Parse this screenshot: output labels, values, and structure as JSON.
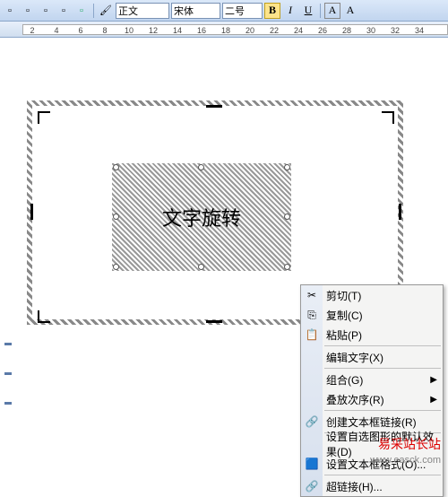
{
  "toolbar": {
    "style_value": "正文",
    "font_value": "宋体",
    "size_value": "二号",
    "bold": "B",
    "italic": "I",
    "underline": "U",
    "abox": "A",
    "abox2": "A"
  },
  "ruler": {
    "ticks": [
      2,
      4,
      6,
      8,
      10,
      12,
      14,
      16,
      18,
      20,
      22,
      24,
      26,
      28,
      30,
      32,
      34
    ]
  },
  "textbox": {
    "content": "文字旋转"
  },
  "context_menu": {
    "items": [
      {
        "icon": "✂",
        "label": "剪切",
        "key": "(T)"
      },
      {
        "icon": "⎘",
        "label": "复制",
        "key": "(C)"
      },
      {
        "icon": "📋",
        "label": "粘贴",
        "key": "(P)"
      },
      {
        "sep": true
      },
      {
        "icon": "",
        "label": "编辑文字",
        "key": "(X)"
      },
      {
        "sep": true
      },
      {
        "icon": "",
        "label": "组合",
        "key": "(G)",
        "submenu": true
      },
      {
        "icon": "",
        "label": "叠放次序",
        "key": "(R)",
        "submenu": true
      },
      {
        "sep": true
      },
      {
        "icon": "🔗",
        "label": "创建文本框链接",
        "key": "(R)"
      },
      {
        "sep": true
      },
      {
        "icon": "",
        "label": "设置自选图形的默认效果",
        "key": "(D)"
      },
      {
        "icon": "🟦",
        "label": "设置文本框格式",
        "key": "(O)..."
      },
      {
        "sep": true
      },
      {
        "icon": "🔗",
        "label": "超链接",
        "key": "(H)..."
      }
    ]
  },
  "watermark": {
    "text": "易采站长站",
    "url": "www.easck.com"
  }
}
